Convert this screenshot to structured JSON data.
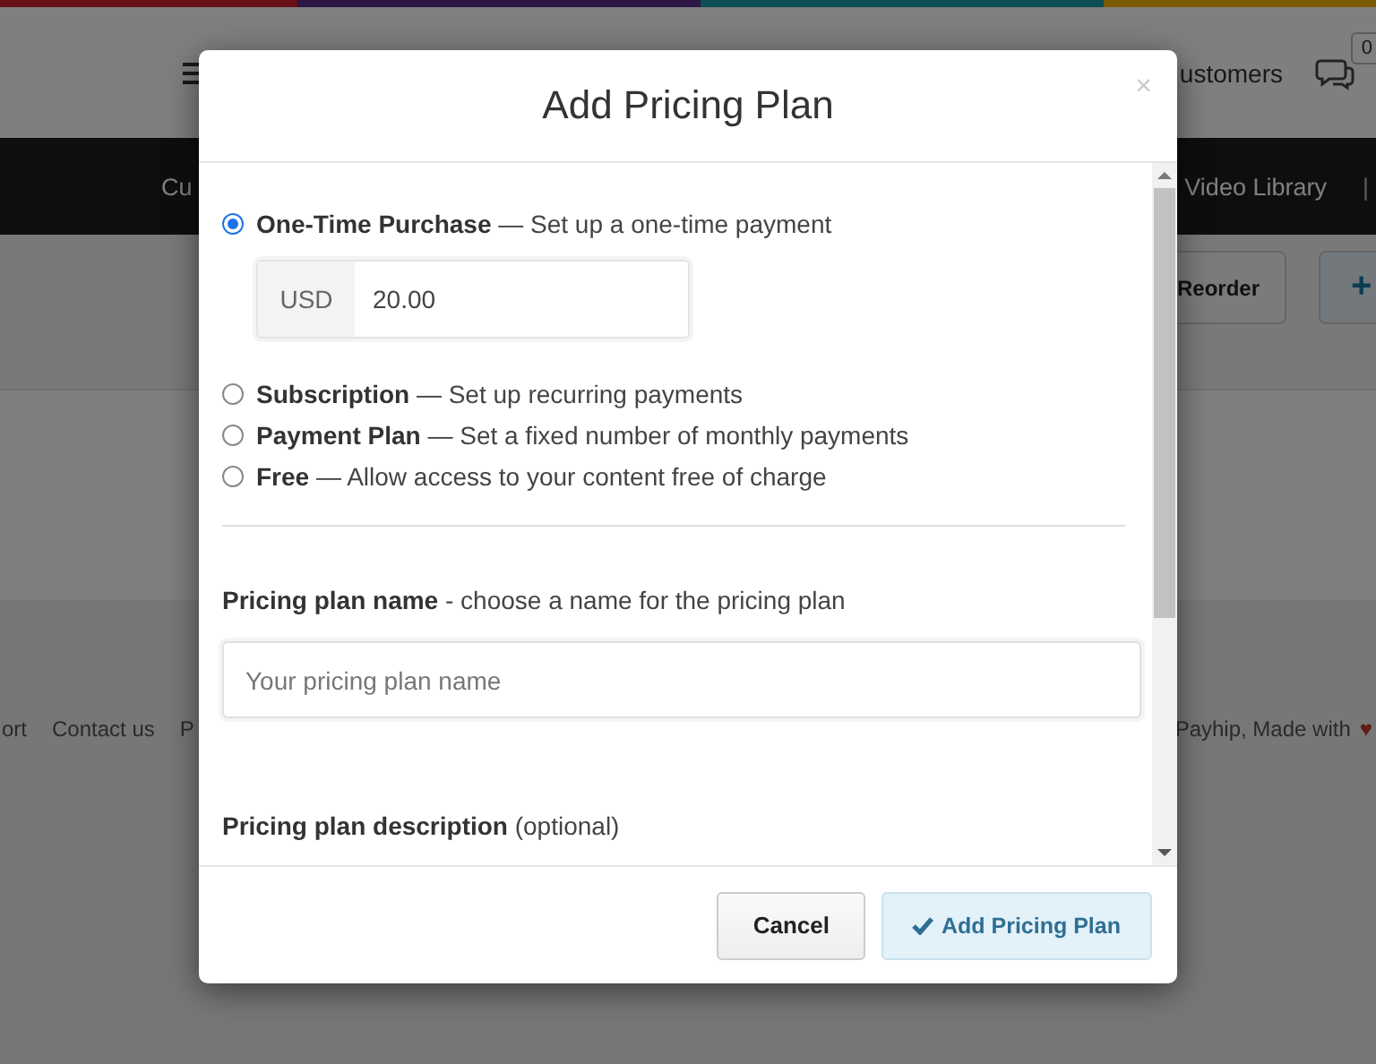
{
  "background": {
    "header": {
      "link": "ustomers",
      "notification_count": "0"
    },
    "nav": {
      "items": [
        "Cu",
        "Video Library"
      ],
      "separator": "|"
    },
    "toolbar": {
      "buttons": [
        {
          "label": "Reorder",
          "kind": "default"
        },
        {
          "label": "+",
          "kind": "primary"
        }
      ]
    },
    "footer": {
      "links": [
        "ort",
        "Contact us",
        "P"
      ],
      "credit": "Payhip, Made with",
      "heart": "♥"
    }
  },
  "modal": {
    "title": "Add Pricing Plan",
    "close": "×",
    "options": [
      {
        "text": "**One-Time Purchase** — Set up a one-time payment",
        "selected": true
      },
      {
        "text": "**Subscription** — Set up recurring payments",
        "selected": false
      },
      {
        "text": "**Payment Plan** — Set a fixed number of monthly payments",
        "selected": false
      },
      {
        "text": "**Free** — Allow access to your content free of charge",
        "selected": false
      }
    ],
    "price": {
      "currency": "USD",
      "value": "20.00"
    },
    "name_field": {
      "label": "**Pricing plan name** - choose a name for the pricing plan",
      "placeholder": "Your pricing plan name"
    },
    "description_label": "**Pricing plan description** (optional)",
    "buttons": [
      {
        "label": "Cancel",
        "kind": "default"
      },
      {
        "label": "Add Pricing Plan",
        "kind": "primary"
      }
    ]
  }
}
